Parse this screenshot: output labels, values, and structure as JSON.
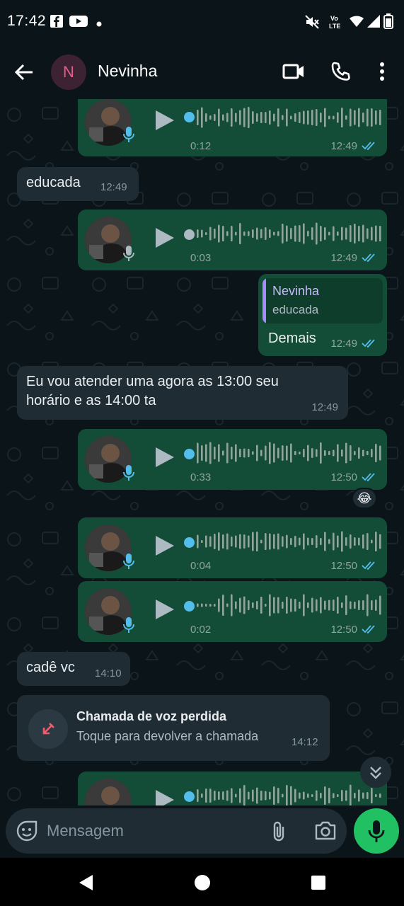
{
  "status_bar": {
    "time": "17:42",
    "icons": [
      "facebook-icon",
      "youtube-icon",
      "notification-dot-icon",
      "mute-icon",
      "volte-icon",
      "wifi-icon",
      "signal-icon",
      "battery-icon"
    ],
    "volte_label_1": "Vo",
    "volte_label_2": "LTE"
  },
  "header": {
    "avatar_initial": "N",
    "contact_name": "Nevinha",
    "icons": [
      "back-arrow-icon",
      "video-call-icon",
      "voice-call-icon",
      "more-vert-icon"
    ]
  },
  "messages": [
    {
      "type": "voice",
      "direction": "out",
      "duration": "0:12",
      "time": "12:49",
      "played": true
    },
    {
      "type": "text",
      "direction": "in",
      "text": "educada",
      "time": "12:49"
    },
    {
      "type": "voice",
      "direction": "out",
      "duration": "0:03",
      "time": "12:49",
      "played": false
    },
    {
      "type": "reply",
      "direction": "out",
      "quote_name": "Nevinha",
      "quote_text": "educada",
      "text": "Demais",
      "time": "12:49"
    },
    {
      "type": "text",
      "direction": "in",
      "text_line1": "Eu vou atender uma agora as 13:00 seu",
      "text_line2": "horário e as 14:00 ta",
      "time": "12:49"
    },
    {
      "type": "voice",
      "direction": "out",
      "duration": "0:33",
      "time": "12:50",
      "played": true,
      "reaction": "😂"
    },
    {
      "type": "voice",
      "direction": "out",
      "duration": "0:04",
      "time": "12:50",
      "played": true
    },
    {
      "type": "voice",
      "direction": "out",
      "duration": "0:02",
      "time": "12:50",
      "played": true
    },
    {
      "type": "text",
      "direction": "in",
      "text": "cadê vc",
      "time": "14:10"
    },
    {
      "type": "missed_call",
      "direction": "in",
      "title": "Chamada de voz perdida",
      "subtitle": "Toque para devolver a chamada",
      "time": "14:12"
    },
    {
      "type": "voice",
      "direction": "out",
      "partial": true
    }
  ],
  "input": {
    "placeholder": "Mensagem",
    "icons": [
      "sticker-icon",
      "attach-icon",
      "camera-icon",
      "mic-icon"
    ]
  },
  "colors": {
    "background": "#0b1418",
    "outgoing_bubble": "#134d37",
    "incoming_bubble": "#1f2c34",
    "accent_green": "#21c063",
    "read_ticks": "#53bdeb"
  },
  "nav": {
    "icons": [
      "nav-back-icon",
      "nav-home-icon",
      "nav-recents-icon"
    ]
  }
}
